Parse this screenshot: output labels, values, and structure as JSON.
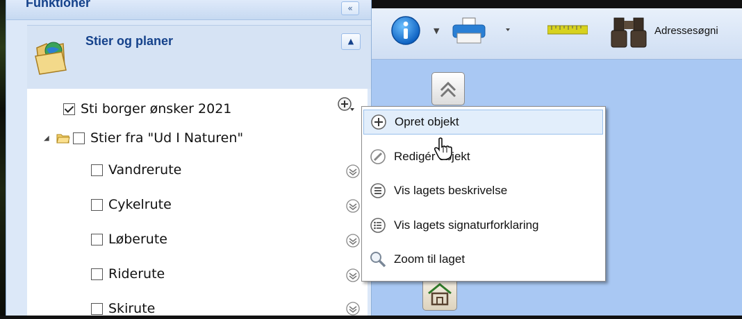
{
  "panel": {
    "header_title": "Funktioner",
    "collapse_glyph": "«",
    "section_title": "Stier og planer",
    "section_glyph": "▲"
  },
  "tree": {
    "items": [
      {
        "label": "Sti borger ønsker 2021",
        "checked": true,
        "action": "add-layer-icon"
      },
      {
        "label": "Stier fra \"Ud I Naturen\"",
        "checked": false,
        "action": "none"
      },
      {
        "label": "Vandrerute",
        "checked": false,
        "action": "expand-icon"
      },
      {
        "label": "Cykelrute",
        "checked": false,
        "action": "expand-icon"
      },
      {
        "label": "Løberute",
        "checked": false,
        "action": "expand-icon"
      },
      {
        "label": "Riderute",
        "checked": false,
        "action": "expand-icon"
      },
      {
        "label": "Skirute",
        "checked": false,
        "action": "expand-icon"
      }
    ]
  },
  "toolbar": {
    "address_label": "Adressesøgni",
    "icons": [
      "info-icon",
      "print-icon",
      "ruler-icon",
      "binoculars-icon"
    ]
  },
  "context_menu": {
    "items": [
      {
        "label": "Opret objekt",
        "icon": "add-icon"
      },
      {
        "label": "Redigér objekt",
        "icon": "edit-icon"
      },
      {
        "label": "Vis lagets beskrivelse",
        "icon": "description-icon"
      },
      {
        "label": "Vis lagets signaturforklaring",
        "icon": "legend-icon"
      },
      {
        "label": "Zoom til laget",
        "icon": "zoom-icon"
      }
    ]
  },
  "colors": {
    "panel_title": "#15428b",
    "map_background": "#a9c8f3",
    "menu_hover": "#e2eefb"
  }
}
